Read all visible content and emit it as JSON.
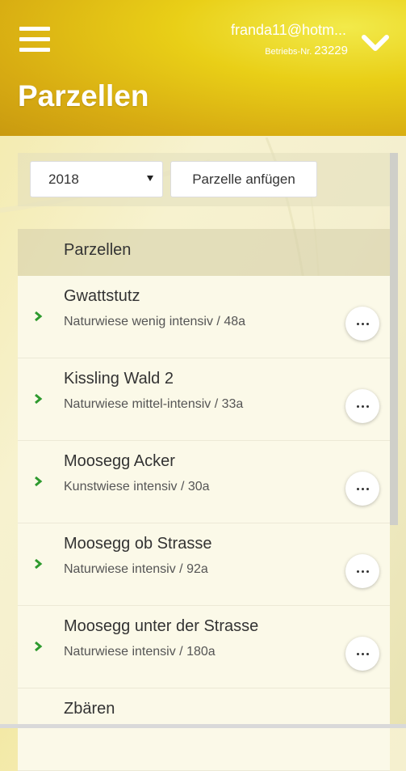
{
  "header": {
    "user_email": "franda11@hotm...",
    "betrieb_label": "Betriebs-Nr.",
    "betrieb_number": "23229",
    "title": "Parzellen"
  },
  "toolbar": {
    "year_value": "2018",
    "add_label": "Parzelle anfügen"
  },
  "list": {
    "header": "Parzellen",
    "items": [
      {
        "name": "Gwattstutz",
        "sub": "Naturwiese wenig intensiv / 48a"
      },
      {
        "name": "Kissling Wald 2",
        "sub": "Naturwiese mittel-intensiv / 33a"
      },
      {
        "name": "Moosegg Acker",
        "sub": "Kunstwiese intensiv / 30a"
      },
      {
        "name": "Moosegg ob Strasse",
        "sub": "Naturwiese intensiv / 92a"
      },
      {
        "name": "Moosegg unter der Strasse",
        "sub": "Naturwiese intensiv / 180a"
      },
      {
        "name": "Zbären",
        "sub": ""
      }
    ]
  },
  "icons": [
    "hamburger-menu-icon",
    "chevron-down-icon",
    "chevron-right-icon",
    "more-options-icon"
  ],
  "colors": {
    "accent_green": "#2e9a2e",
    "header_yellow": "#e9cf17"
  }
}
